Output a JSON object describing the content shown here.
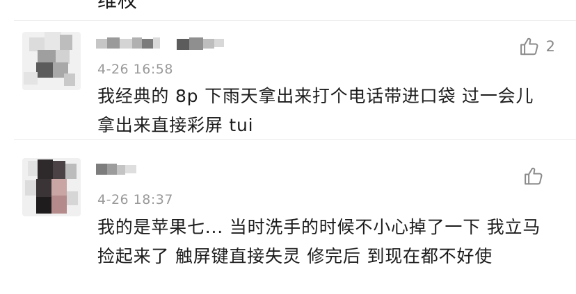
{
  "partial_previous_text": "维权",
  "comments": [
    {
      "timestamp": "4-26 16:58",
      "text": "我经典的 8p 下雨天拿出来打个电话带进口袋 过一会儿拿出来直接彩屏  tui",
      "like_count": "2",
      "like_icon": "thumbs-up-icon"
    },
    {
      "timestamp": "4-26 18:37",
      "text": "我的是苹果七... 当时洗手的时候不小心掉了一下 我立马捡起来了 触屏键直接失灵 修完后 到现在都不好使",
      "like_count": "",
      "like_icon": "thumbs-up-icon"
    }
  ]
}
